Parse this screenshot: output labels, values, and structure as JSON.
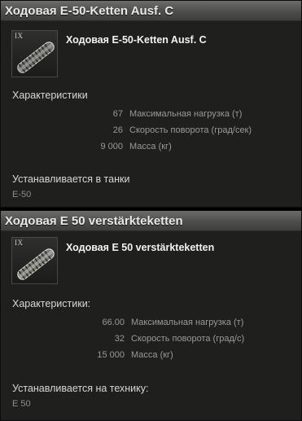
{
  "card1": {
    "header": "Ходовая E-50-Ketten Ausf. C",
    "tier": "IX",
    "icon": "tank-tracks-icon",
    "name": "Ходовая E-50-Ketten Ausf. C",
    "characteristics_label": "Характеристики",
    "stats": [
      {
        "value": "67",
        "label": "Максимальная нагрузка (т)"
      },
      {
        "value": "26",
        "label": "Скорость поворота (град/сек)"
      },
      {
        "value": "9 000",
        "label": "Масса (кг)"
      }
    ],
    "installed_label": "Устанавливается в танки",
    "tanks": "E-50"
  },
  "card2": {
    "header": "Ходовая E 50 verstärkteketten",
    "tier": "IX",
    "icon": "tank-tracks-icon",
    "name": "Ходовая E 50 verstärkteketten",
    "characteristics_label": "Характеристики:",
    "stats": [
      {
        "value": "66.00",
        "label": "Максимальная нагрузка (т)"
      },
      {
        "value": "32",
        "label": "Скорость поворота (град/с)"
      },
      {
        "value": "15 000",
        "label": "Масса (кг)"
      }
    ],
    "installed_label": "Устанавливается на технику:",
    "tanks": "E 50"
  }
}
